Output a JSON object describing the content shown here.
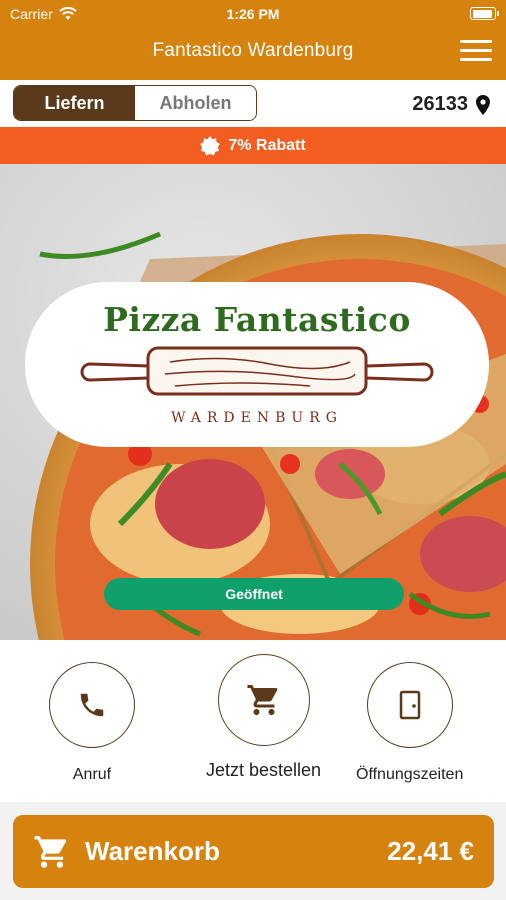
{
  "status_bar": {
    "carrier": "Carrier",
    "time": "1:26 PM"
  },
  "header": {
    "title": "Fantastico Wardenburg"
  },
  "delivery_toggle": {
    "deliver": "Liefern",
    "pickup": "Abholen",
    "selected": "Liefern"
  },
  "location": {
    "zip": "26133"
  },
  "promo": {
    "text": "7% Rabatt"
  },
  "hero": {
    "logo_title": "Pizza Fantastico",
    "logo_subtitle": "WARDENBURG",
    "status_button": "Geöffnet"
  },
  "actions": {
    "call": "Anruf",
    "order": "Jetzt bestellen",
    "hours": "Öffnungszeiten"
  },
  "cart": {
    "label": "Warenkorb",
    "total": "22,41 €"
  },
  "colors": {
    "primary": "#d5820f",
    "brown": "#5a3a1b",
    "promo": "#f25d22",
    "open": "#0fa06b"
  }
}
